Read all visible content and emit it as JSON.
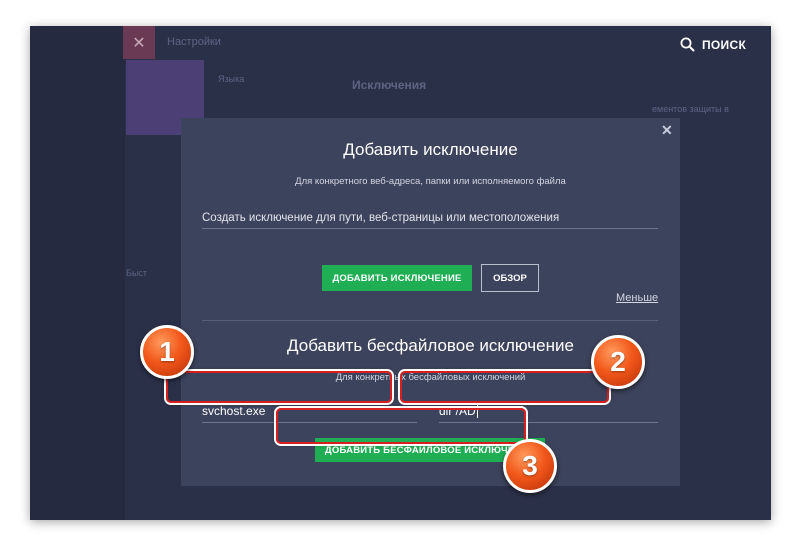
{
  "app": {
    "settings_title": "Настройки",
    "close_tile": "✕",
    "search_label": "ПОИСК",
    "bg_lang": "Языка",
    "bg_exclusions": "Исключения",
    "bg_right_text": "ементов защиты в",
    "bg_left_text": "Быст"
  },
  "modal": {
    "close": "✕",
    "section1": {
      "title": "Добавить исключение",
      "subtitle": "Для конкретного веб-адреса, папки или исполняемого файла",
      "path_value": "Создать исключение для пути, веб-страницы или местоположения",
      "add_button": "ДОБАВИТЬ ИСКЛЮЧЕНИЕ",
      "browse_button": "ОБЗОР",
      "less_link": "Меньше"
    },
    "section2": {
      "title": "Добавить бесфайловое исключение",
      "subtitle": "Для конкретных бесфайловых исключений",
      "process_value": "svchost.exe",
      "command_value": "dir /AD",
      "add_button": "ДОБАВИТЬ БЕСФАЙЛОВОЕ ИСКЛЮЧЕНИЕ"
    }
  },
  "callouts": [
    "1",
    "2",
    "3"
  ],
  "colors": {
    "window_bg": "#2b3049",
    "modal_bg": "#3c435c",
    "accent_green": "#1fae54",
    "highlight_red": "#d81e1e",
    "callout_orange": "#f2581a"
  }
}
